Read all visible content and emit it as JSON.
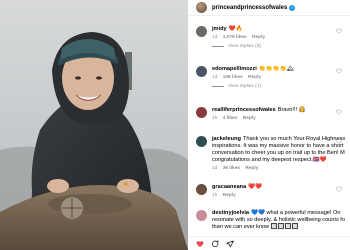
{
  "post": {
    "username": "princeandprincessofwales",
    "verified_mark": "✓"
  },
  "comments": [
    {
      "username": "jmidy",
      "text": "❤️🔥",
      "meta": {
        "time": "1d",
        "likes": "1,079 likes",
        "reply": "Reply"
      },
      "view_replies": "View replies (9)",
      "avatar_color": "#6d6a66"
    },
    {
      "username": "edomapellimozzi",
      "text": "👏👏👏👏🏔",
      "meta": {
        "time": "1d",
        "likes": "108 likes",
        "reply": "Reply"
      },
      "view_replies": "View replies (1)",
      "avatar_color": "#4b5563"
    },
    {
      "username": "realliferprincessofwales",
      "text": "Bravo!!! 👸",
      "meta": {
        "time": "1h",
        "likes": "4 likes",
        "reply": "Reply"
      },
      "avatar_color": "#8b3a3a"
    },
    {
      "username": "jackeleung",
      "text": "Thank you so much Your Royal Highness inspirations. It was my massive honor to have a short conversation to cheer you up on trail up to the Ben! M congratulations and my deepest respect.🇬🇧❤️",
      "meta": {
        "time": "1d",
        "likes": "36 likes",
        "reply": "Reply"
      },
      "avatar_color": "#2f4f4f"
    },
    {
      "username": "gracaaneana",
      "text": "❤️❤️",
      "meta": {
        "time": "1h",
        "likes": "",
        "reply": "Reply"
      },
      "avatar_color": "#6b4e3d"
    },
    {
      "username": "destinyjoelvia",
      "text": "💙💙 what a powerful message! On resonate with so deeply. & holistic wellbeing counts fo than we can ever know 🔲🔲🔲🔲",
      "meta": {
        "time": "",
        "likes": "",
        "reply": ""
      },
      "avatar_color": "#c98d9a"
    }
  ],
  "colors": {
    "heart_red": "#ed4956",
    "verified_blue": "#1d9bf0",
    "meta_gray": "#8e8e8e"
  },
  "footer_icons": [
    "heart-icon",
    "comment-icon",
    "share-icon",
    "bookmark-icon"
  ]
}
